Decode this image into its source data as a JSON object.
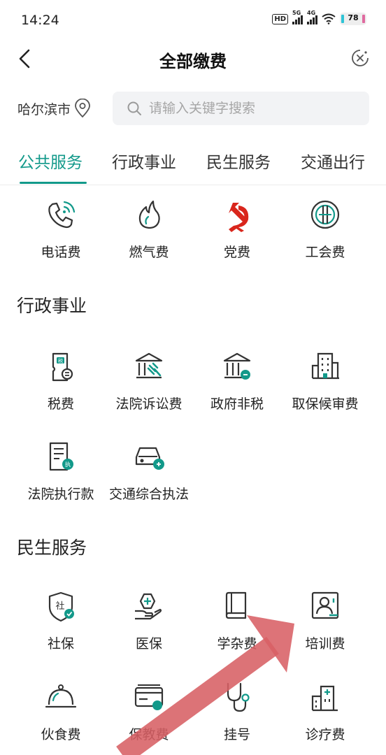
{
  "status": {
    "time": "14:24",
    "hd": "HD",
    "sig1": "5G",
    "sig2": "4G",
    "battery": "78"
  },
  "header": {
    "title": "全部缴费"
  },
  "location": {
    "city": "哈尔滨市"
  },
  "search": {
    "placeholder": "请输入关键字搜索"
  },
  "tabs": [
    {
      "label": "公共服务",
      "active": true
    },
    {
      "label": "行政事业",
      "active": false
    },
    {
      "label": "民生服务",
      "active": false
    },
    {
      "label": "交通出行",
      "active": false
    }
  ],
  "public": {
    "items": [
      {
        "label": "电话费",
        "icon": "phone-icon"
      },
      {
        "label": "燃气费",
        "icon": "flame-icon"
      },
      {
        "label": "党费",
        "icon": "party-emblem-icon"
      },
      {
        "label": "工会费",
        "icon": "union-emblem-icon"
      }
    ]
  },
  "admin": {
    "title": "行政事业",
    "items": [
      {
        "label": "税费",
        "icon": "tax-icon"
      },
      {
        "label": "法院诉讼费",
        "icon": "court-gavel-icon"
      },
      {
        "label": "政府非税",
        "icon": "government-building-icon"
      },
      {
        "label": "取保候审费",
        "icon": "office-building-icon"
      },
      {
        "label": "法院执行款",
        "icon": "court-execution-doc-icon"
      },
      {
        "label": "交通综合执法",
        "icon": "car-enforcement-icon"
      }
    ]
  },
  "livelihood": {
    "title": "民生服务",
    "items": [
      {
        "label": "社保",
        "icon": "social-security-shield-icon"
      },
      {
        "label": "医保",
        "icon": "medical-insurance-icon"
      },
      {
        "label": "学杂费",
        "icon": "book-icon"
      },
      {
        "label": "培训费",
        "icon": "training-person-icon"
      },
      {
        "label": "伙食费",
        "icon": "food-cloche-icon"
      },
      {
        "label": "保教费",
        "icon": "childcare-card-icon"
      },
      {
        "label": "挂号",
        "icon": "stethoscope-icon"
      },
      {
        "label": "诊疗费",
        "icon": "hospital-icon"
      }
    ]
  },
  "theme": {
    "accent": "#12998a",
    "party_red": "#d9261c",
    "arrow": "#d86065"
  }
}
